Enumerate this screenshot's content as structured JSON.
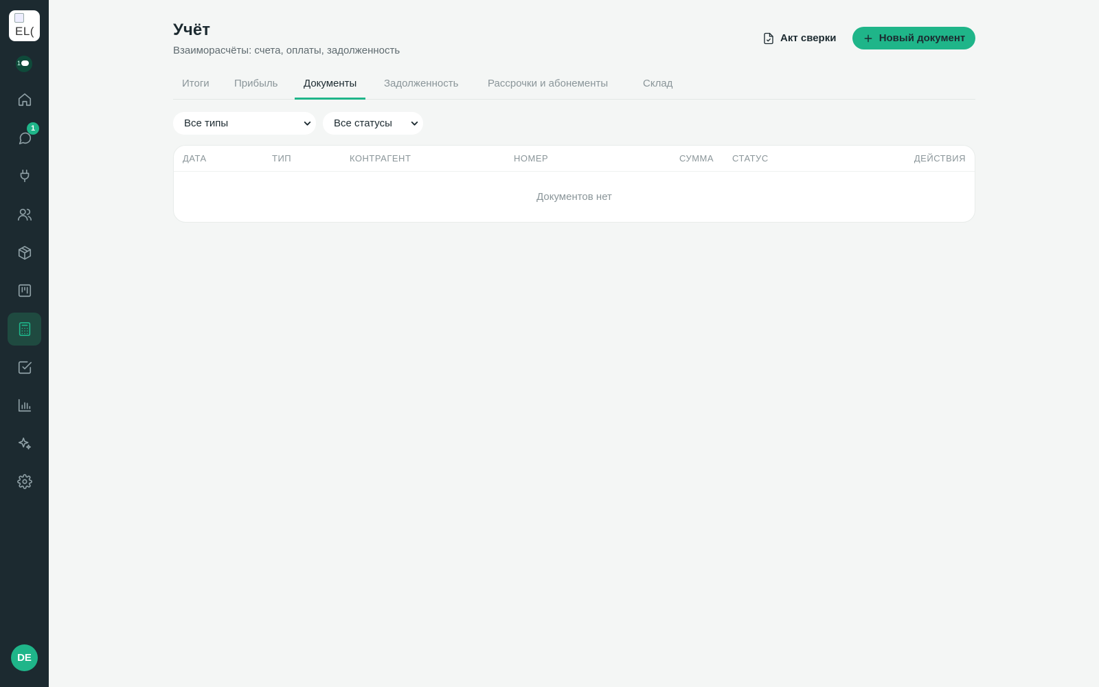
{
  "sidebar": {
    "logo_text": "EL(",
    "chat_count": "1",
    "messages_badge": "1",
    "avatar_initials": "DE",
    "items": [
      {
        "name": "home-icon",
        "active": false
      },
      {
        "name": "chat-icon",
        "active": false
      },
      {
        "name": "plug-icon",
        "active": false
      },
      {
        "name": "users-icon",
        "active": false
      },
      {
        "name": "box-icon",
        "active": false
      },
      {
        "name": "kanban-icon",
        "active": false
      },
      {
        "name": "calculator-icon",
        "active": true
      },
      {
        "name": "checkbox-icon",
        "active": false
      },
      {
        "name": "bar-chart-icon",
        "active": false
      },
      {
        "name": "sparkle-icon",
        "active": false
      },
      {
        "name": "gear-icon",
        "active": false
      }
    ],
    "accent_color": "#1fb589",
    "background_color": "#1c2a30"
  },
  "header": {
    "title": "Учёт",
    "subtitle": "Взаиморасчёты: счета, оплаты, задолженность",
    "act_button": "Акт сверки",
    "new_button": "Новый документ"
  },
  "tabs": [
    {
      "label": "Итоги",
      "active": false
    },
    {
      "label": "Прибыль",
      "active": false
    },
    {
      "label": "Документы",
      "active": true
    },
    {
      "label": "Задолженность",
      "active": false
    },
    {
      "label": "Рассрочки и абонементы",
      "active": false
    },
    {
      "label": "Склад",
      "active": false
    }
  ],
  "filters": {
    "type_selected": "Все типы",
    "status_selected": "Все статусы"
  },
  "table": {
    "columns": [
      "ДАТА",
      "ТИП",
      "КОНТРАГЕНТ",
      "НОМЕР",
      "СУММА",
      "СТАТУС",
      "ДЕЙСТВИЯ"
    ],
    "empty_text": "Документов нет"
  }
}
